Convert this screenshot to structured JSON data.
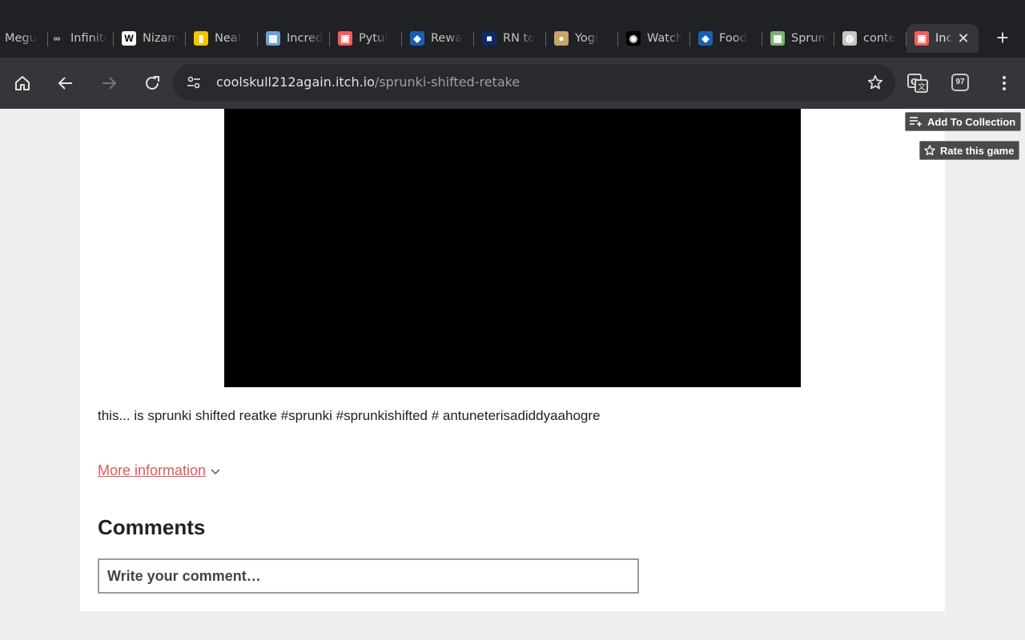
{
  "browser": {
    "tabs": [
      {
        "title": "Megu",
        "icon": "site-icon",
        "color": "#555"
      },
      {
        "title": "Infinite",
        "icon": "infinity-icon",
        "color": "#202124"
      },
      {
        "title": "Nizam",
        "icon": "wikipedia-icon",
        "color": "#fff"
      },
      {
        "title": "Neal",
        "icon": "neal-icon",
        "color": "#f5c400"
      },
      {
        "title": "Incredibox",
        "icon": "incredibox-icon",
        "color": "#6aa0d8"
      },
      {
        "title": "Pytul",
        "icon": "itch-icon",
        "color": "#fa5c5c"
      },
      {
        "title": "Rewa",
        "icon": "rewards-icon",
        "color": "#1a5fb4"
      },
      {
        "title": "RN to",
        "icon": "rn-icon",
        "color": "#0b2a66"
      },
      {
        "title": "Yogi",
        "icon": "planet-icon",
        "color": "#c9a36b"
      },
      {
        "title": "Watch",
        "icon": "watch-icon",
        "color": "#000"
      },
      {
        "title": "Food",
        "icon": "rewards-icon",
        "color": "#1a5fb4"
      },
      {
        "title": "Sprunki",
        "icon": "sprunki-icon",
        "color": "#7bb274"
      },
      {
        "title": "conte",
        "icon": "globe-icon",
        "color": "#c4c7c5"
      },
      {
        "title": "Incredibox",
        "icon": "itch-icon",
        "color": "#fa5c5c",
        "active": true
      }
    ],
    "url_host": "coolskull212again.itch.io",
    "url_path": "/sprunki-shifted-retake",
    "extension_badge": "97"
  },
  "page": {
    "add_to_collection": "Add To Collection",
    "rate_game": "Rate this game",
    "description": "this... is sprunki shifted reatke #sprunki #sprunkishifted # antuneterisadiddyaahogre",
    "more_information": "More information",
    "comments_heading": "Comments",
    "comment_placeholder": "Write your comment…"
  }
}
